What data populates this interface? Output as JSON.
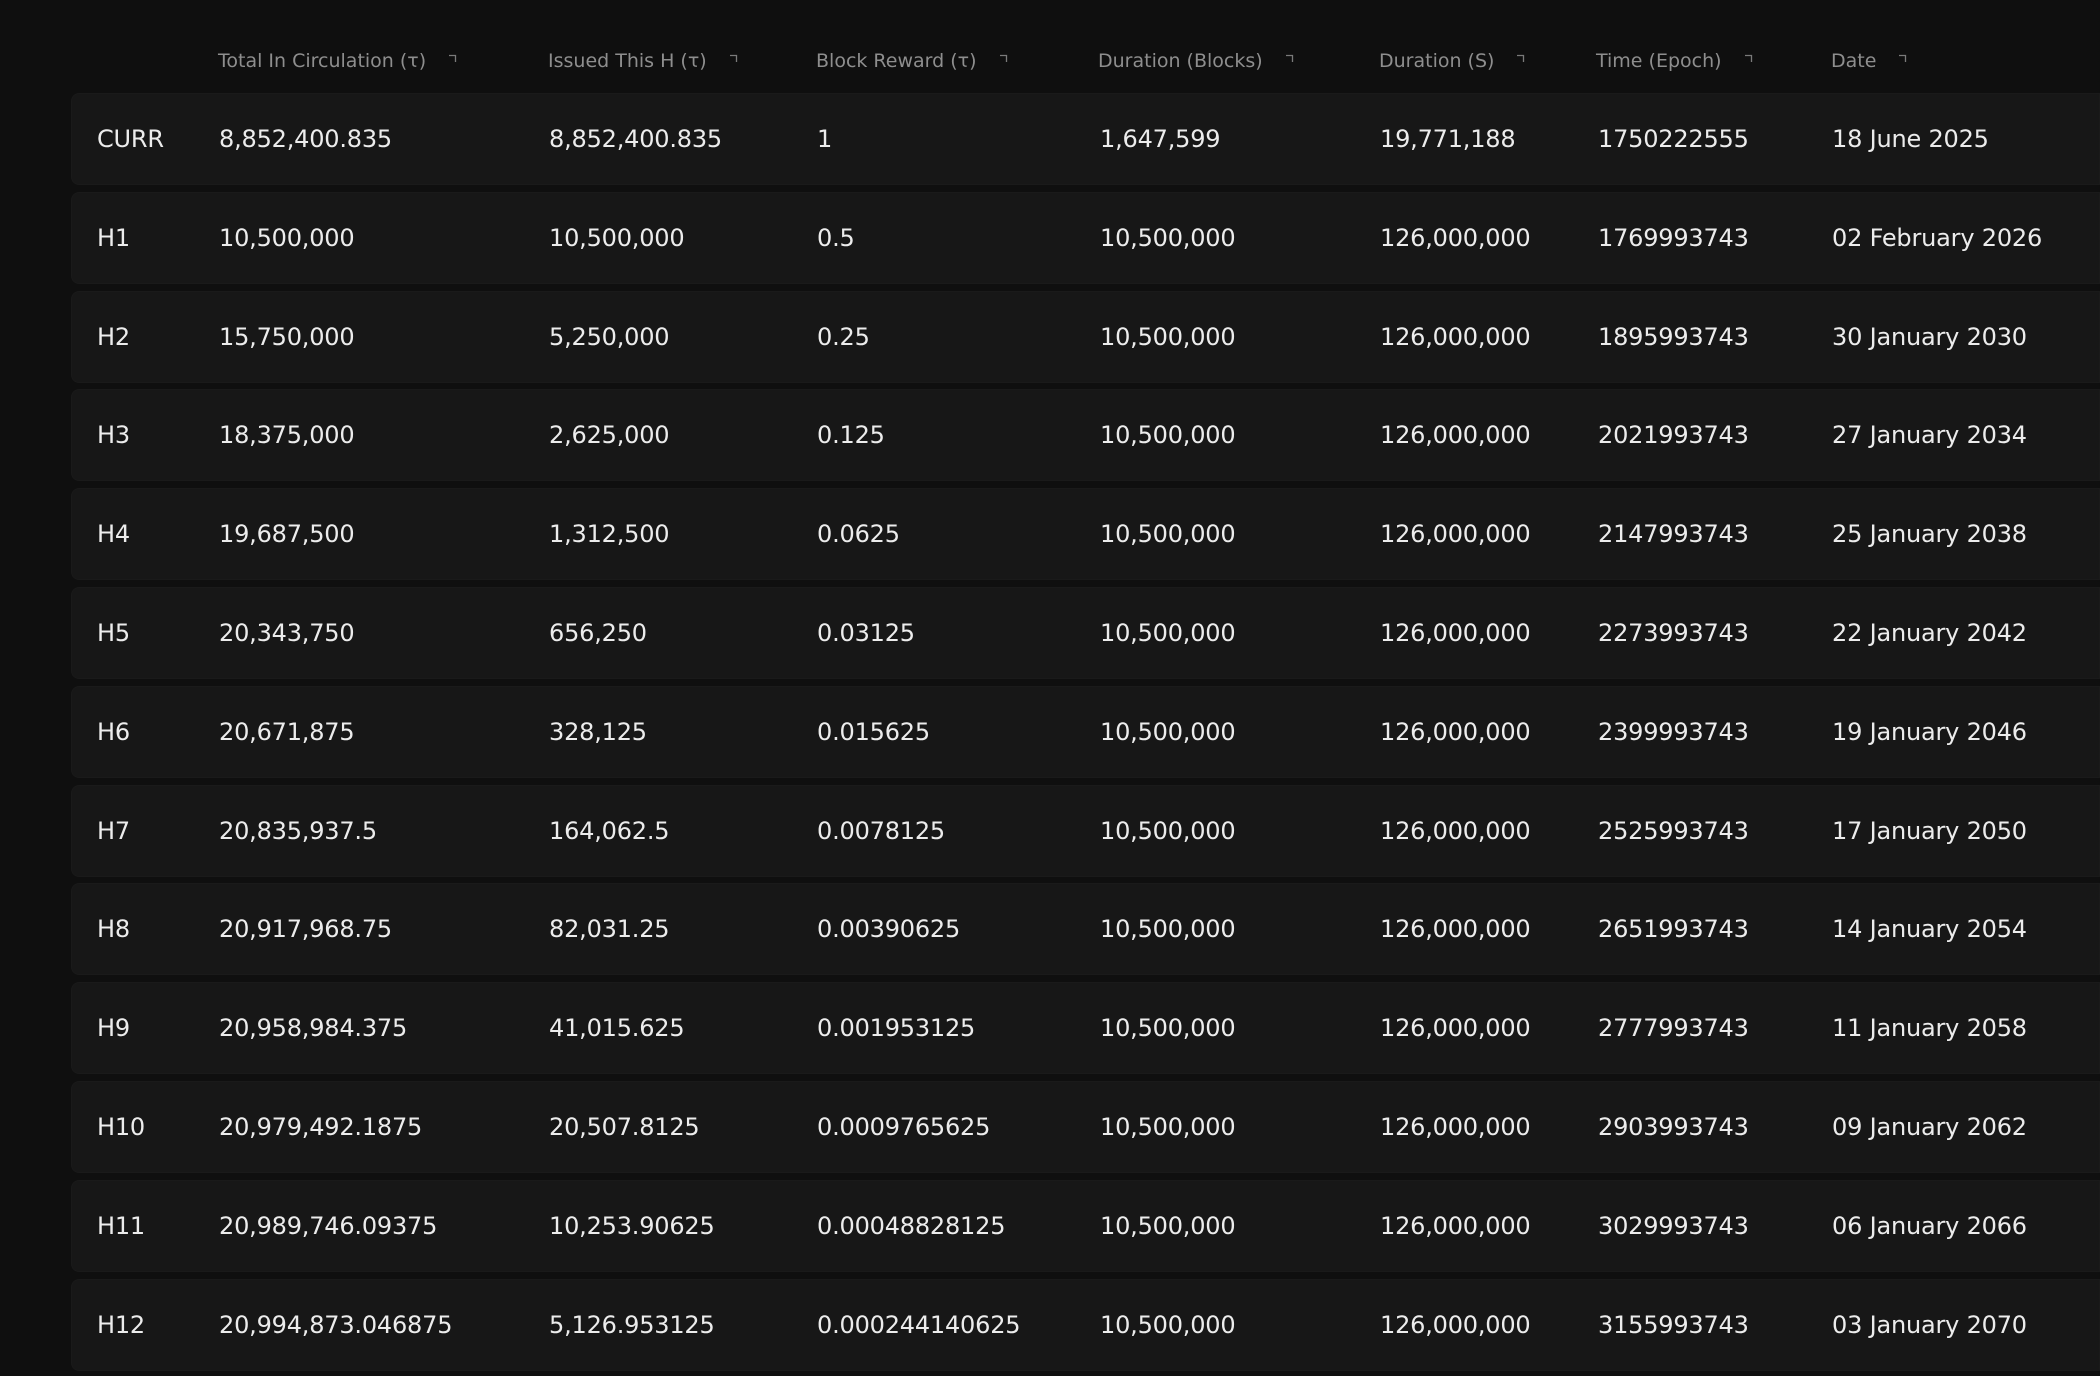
{
  "table": {
    "headers": [
      {
        "label": "",
        "sortable": false
      },
      {
        "label": "Total In Circulation (τ)",
        "sortable": true
      },
      {
        "label": "Issued This H (τ)",
        "sortable": true
      },
      {
        "label": "Block Reward (τ)",
        "sortable": true
      },
      {
        "label": "Duration (Blocks)",
        "sortable": true
      },
      {
        "label": "Duration (S)",
        "sortable": true
      },
      {
        "label": "Time (Epoch)",
        "sortable": true
      },
      {
        "label": "Date",
        "sortable": true
      }
    ],
    "rows": [
      [
        "CURR",
        "8,852,400.835",
        "8,852,400.835",
        "1",
        "1,647,599",
        "19,771,188",
        "1750222555",
        "18 June 2025"
      ],
      [
        "H1",
        "10,500,000",
        "10,500,000",
        "0.5",
        "10,500,000",
        "126,000,000",
        "1769993743",
        "02 February 2026"
      ],
      [
        "H2",
        "15,750,000",
        "5,250,000",
        "0.25",
        "10,500,000",
        "126,000,000",
        "1895993743",
        "30 January 2030"
      ],
      [
        "H3",
        "18,375,000",
        "2,625,000",
        "0.125",
        "10,500,000",
        "126,000,000",
        "2021993743",
        "27 January 2034"
      ],
      [
        "H4",
        "19,687,500",
        "1,312,500",
        "0.0625",
        "10,500,000",
        "126,000,000",
        "2147993743",
        "25 January 2038"
      ],
      [
        "H5",
        "20,343,750",
        "656,250",
        "0.03125",
        "10,500,000",
        "126,000,000",
        "2273993743",
        "22 January 2042"
      ],
      [
        "H6",
        "20,671,875",
        "328,125",
        "0.015625",
        "10,500,000",
        "126,000,000",
        "2399993743",
        "19 January 2046"
      ],
      [
        "H7",
        "20,835,937.5",
        "164,062.5",
        "0.0078125",
        "10,500,000",
        "126,000,000",
        "2525993743",
        "17 January 2050"
      ],
      [
        "H8",
        "20,917,968.75",
        "82,031.25",
        "0.00390625",
        "10,500,000",
        "126,000,000",
        "2651993743",
        "14 January 2054"
      ],
      [
        "H9",
        "20,958,984.375",
        "41,015.625",
        "0.001953125",
        "10,500,000",
        "126,000,000",
        "2777993743",
        "11 January 2058"
      ],
      [
        "H10",
        "20,979,492.1875",
        "20,507.8125",
        "0.0009765625",
        "10,500,000",
        "126,000,000",
        "2903993743",
        "09 January 2062"
      ],
      [
        "H11",
        "20,989,746.09375",
        "10,253.90625",
        "0.00048828125",
        "10,500,000",
        "126,000,000",
        "3029993743",
        "06 January 2066"
      ],
      [
        "H12",
        "20,994,873.046875",
        "5,126.953125",
        "0.000244140625",
        "10,500,000",
        "126,000,000",
        "3155993743",
        "03 January 2070"
      ]
    ]
  },
  "icons": {
    "sort": "sort-icon"
  },
  "colors": {
    "background": "#0f0f0f",
    "row_background": "#171717",
    "header_text": "#8e8e8e",
    "cell_text": "#ececec"
  }
}
